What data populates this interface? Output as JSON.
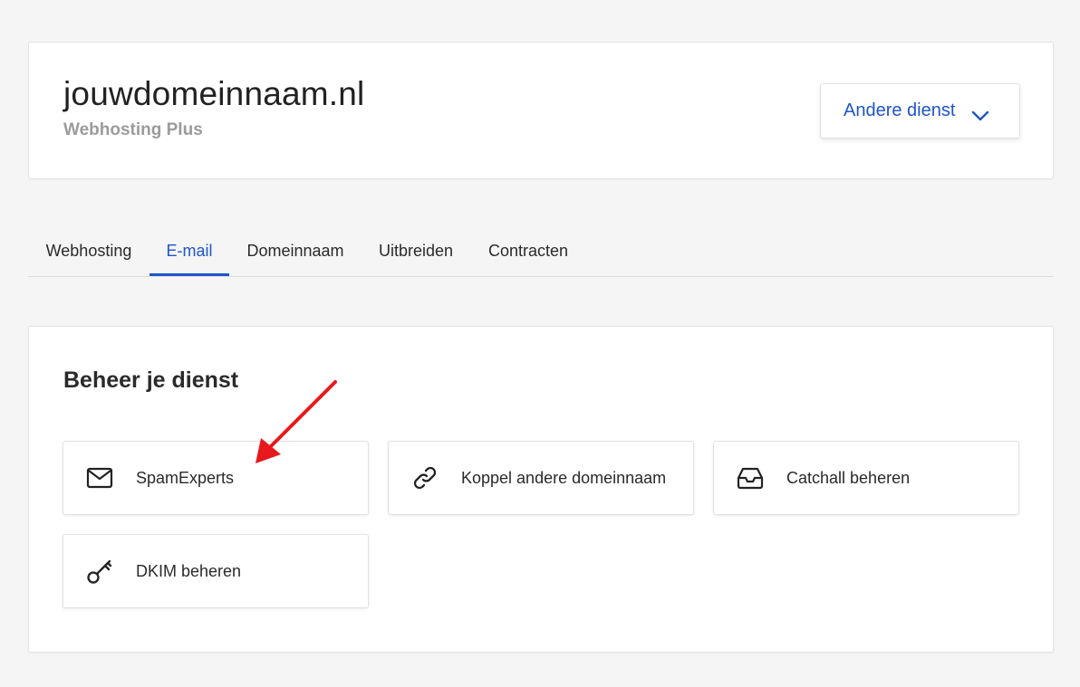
{
  "header": {
    "domain": "jouwdomeinnaam.nl",
    "service": "Webhosting Plus",
    "switch_label": "Andere dienst",
    "switch_icon": "chevron-down-icon"
  },
  "tabs": [
    {
      "label": "Webhosting",
      "active": false
    },
    {
      "label": "E-mail",
      "active": true
    },
    {
      "label": "Domeinnaam",
      "active": false
    },
    {
      "label": "Uitbreiden",
      "active": false
    },
    {
      "label": "Contracten",
      "active": false
    }
  ],
  "manage": {
    "title": "Beheer je dienst",
    "tiles": [
      {
        "label": "SpamExperts",
        "icon": "mail-icon"
      },
      {
        "label": "Koppel andere domeinnaam",
        "icon": "link-icon"
      },
      {
        "label": "Catchall beheren",
        "icon": "inbox-icon"
      },
      {
        "label": "DKIM beheren",
        "icon": "key-icon"
      }
    ]
  },
  "colors": {
    "accent": "#1e55c7",
    "annotation_arrow": "#e8191c",
    "background": "#f5f5f5"
  }
}
